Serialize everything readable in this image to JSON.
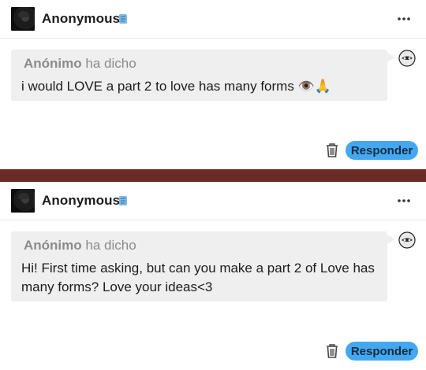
{
  "posts": [
    {
      "username": "Anonymous",
      "asker_name": "Anónimo",
      "asker_suffix": "ha dicho",
      "question": "i would LOVE a part 2 to love has many forms 👁️🙏",
      "reply_label": "Responder"
    },
    {
      "username": "Anonymous",
      "asker_name": "Anónimo",
      "asker_suffix": "ha dicho",
      "question": "Hi! First time asking, but can you make a part 2 of Love has many forms? Love your ideas<3",
      "reply_label": "Responder"
    }
  ],
  "icons": {
    "more": "more-dots-icon",
    "trash": "trash-icon",
    "anon": "anonymous-mask-icon",
    "badge": "scroll-badge-icon"
  },
  "colors": {
    "accent": "#44a8f0",
    "divider": "#6b2a23",
    "bubble": "#efefef"
  }
}
